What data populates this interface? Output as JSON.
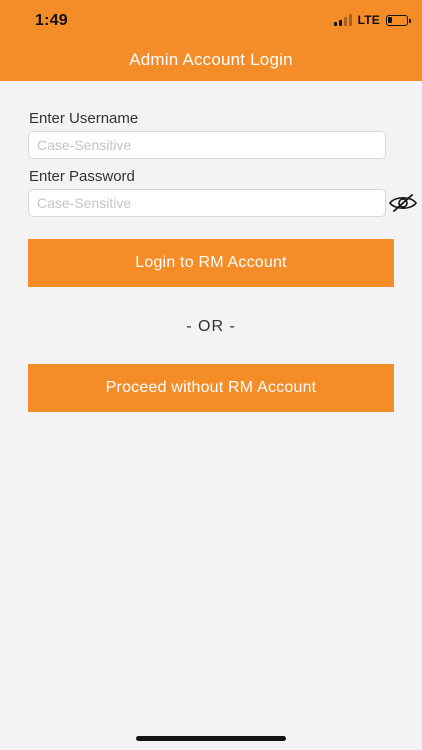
{
  "status_bar": {
    "time": "1:49",
    "network": "LTE",
    "battery_level_fraction": 0.25
  },
  "nav": {
    "title": "Admin Account Login"
  },
  "form": {
    "username_label": "Enter Username",
    "username_placeholder": "Case-Sensitive",
    "username_value": "",
    "password_label": "Enter Password",
    "password_placeholder": "Case-Sensitive",
    "password_value": "",
    "password_toggle_icon": "eye-slash-icon"
  },
  "actions": {
    "login_label": "Login to RM Account",
    "separator": "- OR -",
    "proceed_label": "Proceed without RM Account"
  },
  "colors": {
    "accent": "#f48c28",
    "background": "#f3f3f3",
    "text": "#333333",
    "placeholder": "#c4c4c4"
  }
}
